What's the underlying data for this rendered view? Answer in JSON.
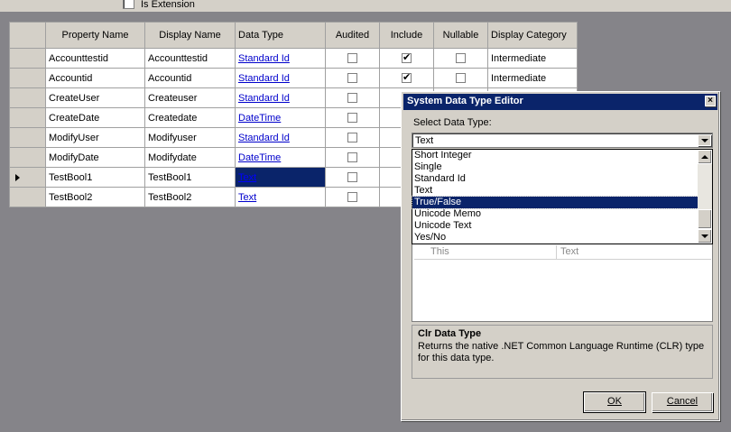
{
  "header": {
    "is_extension_label": "Is Extension"
  },
  "grid": {
    "columns": [
      "Property Name",
      "Display Name",
      "Data Type",
      "Audited",
      "Include",
      "Nullable",
      "Display Category"
    ],
    "rows": [
      {
        "property": "Accounttestid",
        "display": "Accounttestid",
        "type": "Standard Id",
        "audited": false,
        "include": true,
        "nullable": false,
        "category": "Intermediate"
      },
      {
        "property": "Accountid",
        "display": "Accountid",
        "type": "Standard Id",
        "audited": false,
        "include": true,
        "nullable": false,
        "category": "Intermediate"
      },
      {
        "property": "CreateUser",
        "display": "Createuser",
        "type": "Standard Id",
        "audited": false
      },
      {
        "property": "CreateDate",
        "display": "Createdate",
        "type": "DateTime",
        "audited": false
      },
      {
        "property": "ModifyUser",
        "display": "Modifyuser",
        "type": "Standard Id",
        "audited": false
      },
      {
        "property": "ModifyDate",
        "display": "Modifydate",
        "type": "DateTime",
        "audited": false
      },
      {
        "property": "TestBool1",
        "display": "TestBool1",
        "type": "Text",
        "audited": false,
        "current": true
      },
      {
        "property": "TestBool2",
        "display": "TestBool2",
        "type": "Text",
        "audited": false
      }
    ]
  },
  "dialog": {
    "title": "System Data Type Editor",
    "close_glyph": "×",
    "select_label": "Select Data Type:",
    "combo_value": "Text",
    "dropdown_items": [
      "Short Integer",
      "Single",
      "Standard Id",
      "Text",
      "True/False",
      "Unicode Memo",
      "Unicode Text",
      "Yes/No"
    ],
    "dropdown_selected": "True/False",
    "property_row": {
      "name": "This",
      "value": "Text"
    },
    "description_title": "Clr Data Type",
    "description_text": "Returns the native .NET Common Language Runtime (CLR) type for this data type.",
    "ok_label": "OK",
    "cancel_label": "Cancel"
  },
  "colors": {
    "selection": "#0a246a",
    "link": "#0000cc",
    "workspace": "#858489",
    "face": "#d4d0c8"
  }
}
